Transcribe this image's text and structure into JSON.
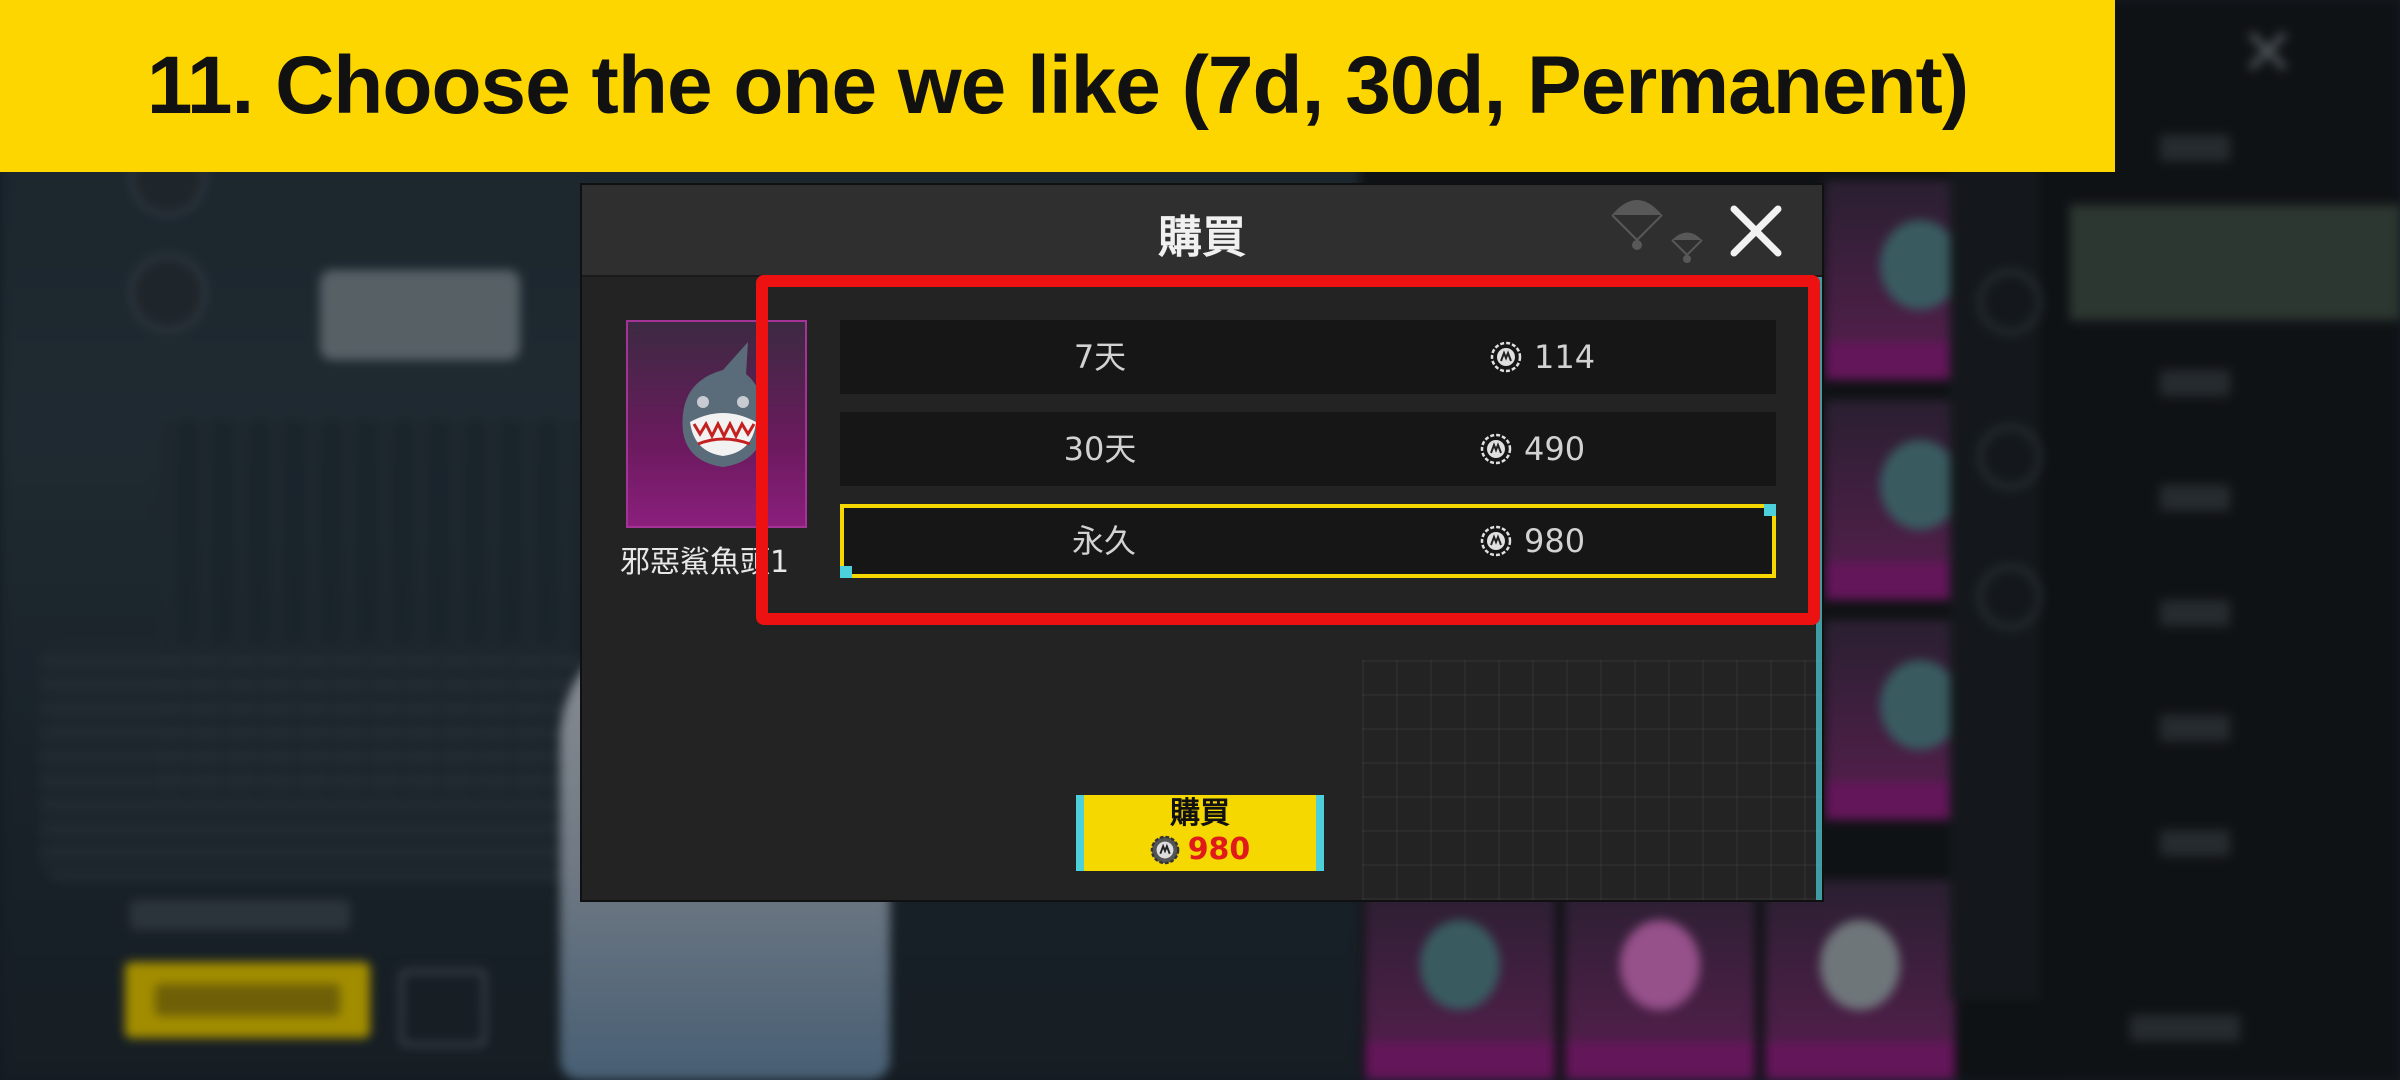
{
  "banner": {
    "text": "11. Choose the one we like (7d, 30d, Permanent)",
    "color": "#fdd600"
  },
  "dialog": {
    "title": "購買",
    "close_icon": "close-icon",
    "item": {
      "name": "邪惡鯊魚頭1",
      "image_icon": "shark-helmet-icon",
      "rarity_color": "#8a1f7c"
    },
    "options": [
      {
        "label": "7天",
        "price": "114",
        "selected": false
      },
      {
        "label": "30天",
        "price": "490",
        "selected": false
      },
      {
        "label": "永久",
        "price": "980",
        "selected": true
      }
    ],
    "currency_icon": "uc-coin-icon",
    "buy_button": {
      "label": "購買",
      "price": "980",
      "color": "#f5d800",
      "price_color": "#e01a1a"
    }
  },
  "annotation": {
    "highlight_color": "#ee1111",
    "selection_color": "#f5d800"
  }
}
